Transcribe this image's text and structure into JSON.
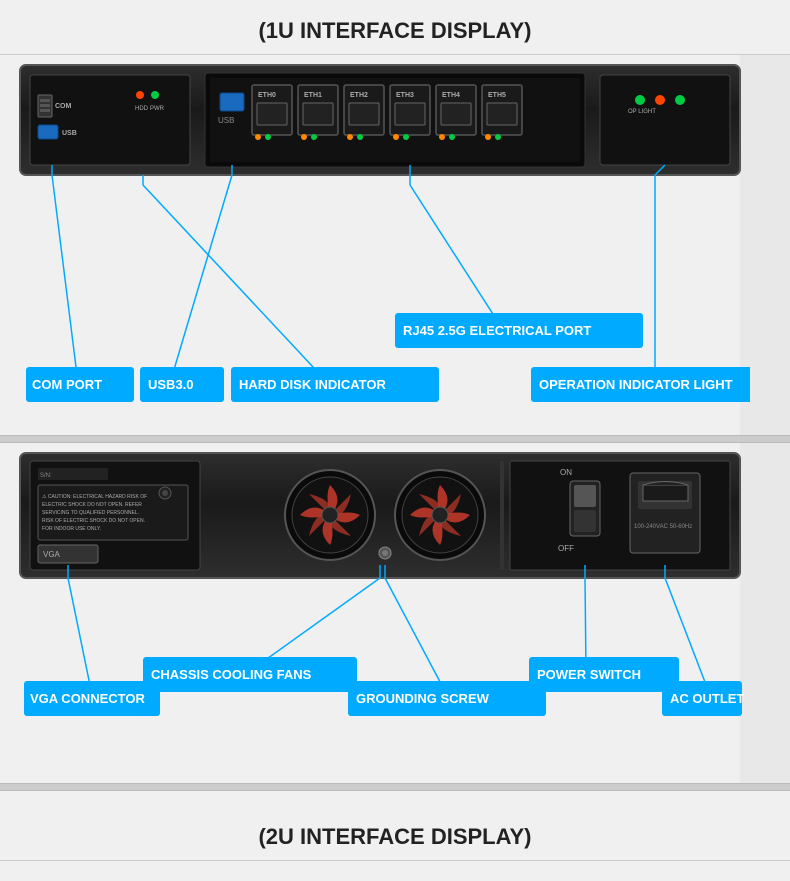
{
  "page": {
    "background_color": "#e8e8e8"
  },
  "section1": {
    "title": "(1U INTERFACE DISPLAY)"
  },
  "section2": {
    "title": "(2U INTERFACE DISPLAY)"
  },
  "labels_1u": {
    "com_port": "COM PORT",
    "usb30": "USB3.0",
    "hard_disk": "HARD DISK INDICATOR",
    "rj45": "RJ45 2.5G ELECTRICAL PORT",
    "operation_light": "OPERATION INDICATOR LIGHT"
  },
  "labels_2u": {
    "vga": "VGA CONNECTOR",
    "fans": "CHASSIS COOLING FANS",
    "grounding": "GROUNDING SCREW",
    "power_switch": "POWER SWITCH",
    "ac_outlet": "AC OUTLET"
  },
  "colors": {
    "label_bg": "#00aaff",
    "label_text": "#ffffff",
    "line_color": "#00aaff"
  }
}
